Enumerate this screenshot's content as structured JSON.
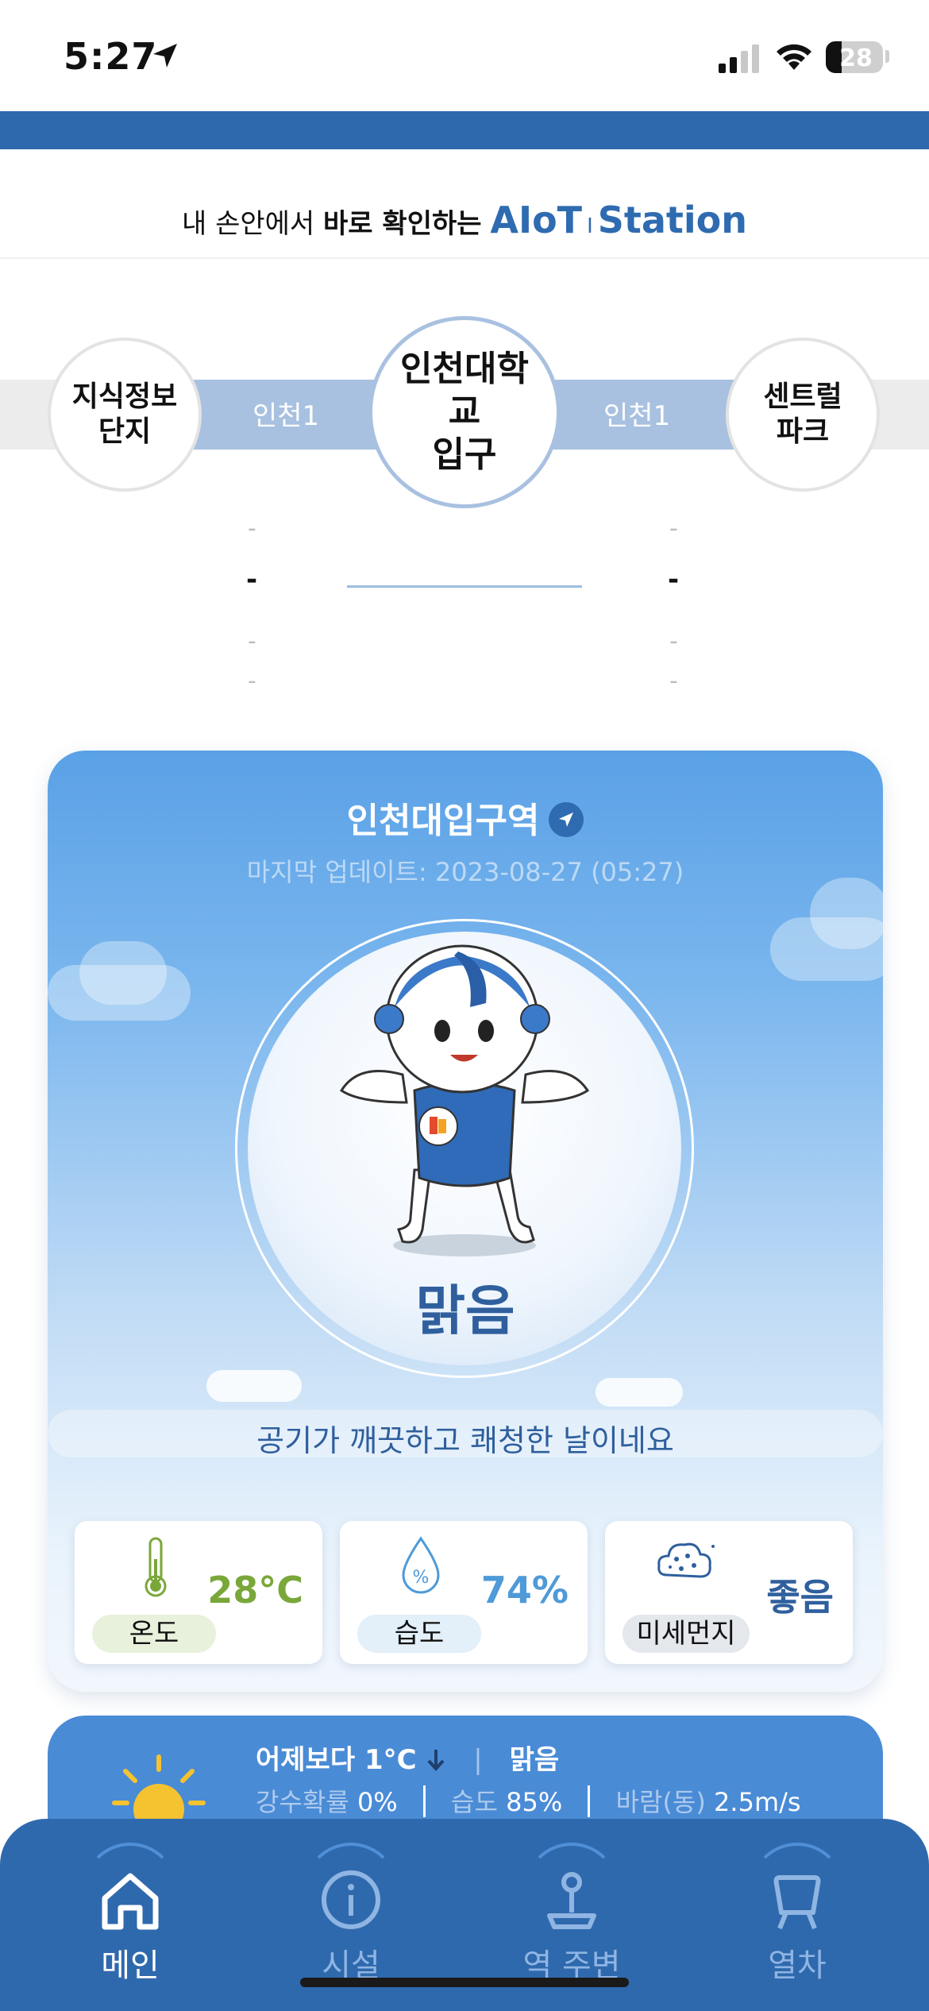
{
  "status_bar": {
    "time": "5:27",
    "battery": "28"
  },
  "header": {
    "tagline_prefix": "내 손안에서",
    "tagline_bold": "바로 확인하는",
    "brand_left": "AIoT",
    "brand_sep": "I",
    "brand_right": "Station"
  },
  "station": {
    "prev": "지식정보\n단지",
    "current": "인천대학교\n입구",
    "next": "센트럴\n파크",
    "line_left": "인천1",
    "line_right": "인천1"
  },
  "arrivals": {
    "left": [
      "-",
      "-",
      "-",
      "-"
    ],
    "right": [
      "-",
      "-",
      "-",
      "-"
    ]
  },
  "air": {
    "title": "인천대입구역",
    "updated": "마지막 업데이트: 2023-08-27 (05:27)",
    "status": "맑음",
    "message": "공기가 깨끗하고 쾌청한 날이네요",
    "metrics": [
      {
        "label": "온도",
        "value": "28°C",
        "icon": "thermometer-icon",
        "color": "#7aa73a",
        "label_bg": "#e7f1dc"
      },
      {
        "label": "습도",
        "value": "74%",
        "icon": "water-drop-icon",
        "color": "#4f9ad8",
        "label_bg": "#e3eff9"
      },
      {
        "label": "미세먼지",
        "value": "좋음",
        "icon": "dust-cloud-icon",
        "color": "#2f5f9d",
        "label_bg": "#e4e7ec"
      }
    ]
  },
  "weather": {
    "compare": "어제보다 1°C",
    "condition": "맑음",
    "precip_label": "강수확률",
    "precip_value": "0%",
    "humidity_label": "습도",
    "humidity_value": "85%",
    "wind_label": "바람(동)",
    "wind_value": "2.5m/s"
  },
  "tabs": [
    {
      "label": "메인",
      "icon": "home-icon",
      "active": true
    },
    {
      "label": "시설",
      "icon": "info-icon",
      "active": false
    },
    {
      "label": "역 주변",
      "icon": "location-pin-icon",
      "active": false
    },
    {
      "label": "열차",
      "icon": "train-icon",
      "active": false
    }
  ],
  "colors": {
    "primary": "#2f69ad",
    "line_blue": "#a9c1e0",
    "accent_dark": "#2f5f9d"
  }
}
